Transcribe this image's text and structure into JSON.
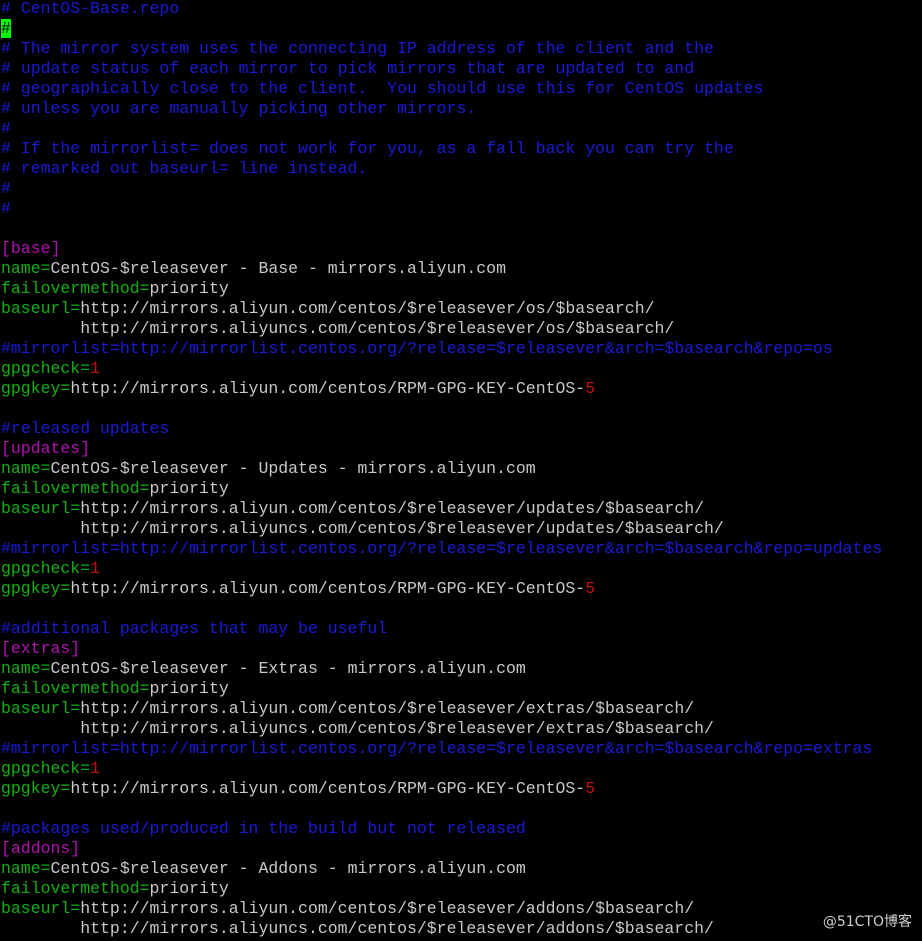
{
  "colors": {
    "background": "#000000",
    "comment": "#1a1ad6",
    "section": "#b010b0",
    "key": "#10b010",
    "value": "#c8c8c8",
    "number": "#c81010",
    "cursor": "#00ff00"
  },
  "lines": [
    [
      {
        "t": "# CentOS-Base.repo",
        "c": "comment"
      }
    ],
    [
      {
        "t": "#",
        "c": "cursor"
      }
    ],
    [
      {
        "t": "# The mirror system uses the connecting IP address of the client and the",
        "c": "comment"
      }
    ],
    [
      {
        "t": "# update status of each mirror to pick mirrors that are updated to and",
        "c": "comment"
      }
    ],
    [
      {
        "t": "# geographically close to the client.  You should use this for CentOS updates",
        "c": "comment"
      }
    ],
    [
      {
        "t": "# unless you are manually picking other mirrors.",
        "c": "comment"
      }
    ],
    [
      {
        "t": "#",
        "c": "comment"
      }
    ],
    [
      {
        "t": "# If the mirrorlist= does not work for you, as a fall back you can try the",
        "c": "comment"
      }
    ],
    [
      {
        "t": "# remarked out baseurl= line instead.",
        "c": "comment"
      }
    ],
    [
      {
        "t": "#",
        "c": "comment"
      }
    ],
    [
      {
        "t": "#",
        "c": "comment"
      }
    ],
    [],
    [
      {
        "t": "[base]",
        "c": "section"
      }
    ],
    [
      {
        "t": "name=",
        "c": "key"
      },
      {
        "t": "CentOS-$releasever - Base - mirrors.aliyun.com",
        "c": "value"
      }
    ],
    [
      {
        "t": "failovermethod=",
        "c": "key"
      },
      {
        "t": "priority",
        "c": "value"
      }
    ],
    [
      {
        "t": "baseurl=",
        "c": "key"
      },
      {
        "t": "http://mirrors.aliyun.com/centos/$releasever/os/$basearch/",
        "c": "value"
      }
    ],
    [
      {
        "t": "        http://mirrors.aliyuncs.com/centos/$releasever/os/$basearch/",
        "c": "value"
      }
    ],
    [
      {
        "t": "#mirrorlist=http://mirrorlist.centos.org/?release=$releasever&arch=$basearch&repo=os",
        "c": "comment"
      }
    ],
    [
      {
        "t": "gpgcheck=",
        "c": "key"
      },
      {
        "t": "1",
        "c": "number"
      }
    ],
    [
      {
        "t": "gpgkey=",
        "c": "key"
      },
      {
        "t": "http://mirrors.aliyun.com/centos/RPM-GPG-KEY-CentOS-",
        "c": "value"
      },
      {
        "t": "5",
        "c": "number"
      }
    ],
    [],
    [
      {
        "t": "#released updates",
        "c": "comment"
      }
    ],
    [
      {
        "t": "[updates]",
        "c": "section"
      }
    ],
    [
      {
        "t": "name=",
        "c": "key"
      },
      {
        "t": "CentOS-$releasever - Updates - mirrors.aliyun.com",
        "c": "value"
      }
    ],
    [
      {
        "t": "failovermethod=",
        "c": "key"
      },
      {
        "t": "priority",
        "c": "value"
      }
    ],
    [
      {
        "t": "baseurl=",
        "c": "key"
      },
      {
        "t": "http://mirrors.aliyun.com/centos/$releasever/updates/$basearch/",
        "c": "value"
      }
    ],
    [
      {
        "t": "        http://mirrors.aliyuncs.com/centos/$releasever/updates/$basearch/",
        "c": "value"
      }
    ],
    [
      {
        "t": "#mirrorlist=http://mirrorlist.centos.org/?release=$releasever&arch=$basearch&repo=updates",
        "c": "comment"
      }
    ],
    [
      {
        "t": "gpgcheck=",
        "c": "key"
      },
      {
        "t": "1",
        "c": "number"
      }
    ],
    [
      {
        "t": "gpgkey=",
        "c": "key"
      },
      {
        "t": "http://mirrors.aliyun.com/centos/RPM-GPG-KEY-CentOS-",
        "c": "value"
      },
      {
        "t": "5",
        "c": "number"
      }
    ],
    [],
    [
      {
        "t": "#additional packages that may be useful",
        "c": "comment"
      }
    ],
    [
      {
        "t": "[extras]",
        "c": "section"
      }
    ],
    [
      {
        "t": "name=",
        "c": "key"
      },
      {
        "t": "CentOS-$releasever - Extras - mirrors.aliyun.com",
        "c": "value"
      }
    ],
    [
      {
        "t": "failovermethod=",
        "c": "key"
      },
      {
        "t": "priority",
        "c": "value"
      }
    ],
    [
      {
        "t": "baseurl=",
        "c": "key"
      },
      {
        "t": "http://mirrors.aliyun.com/centos/$releasever/extras/$basearch/",
        "c": "value"
      }
    ],
    [
      {
        "t": "        http://mirrors.aliyuncs.com/centos/$releasever/extras/$basearch/",
        "c": "value"
      }
    ],
    [
      {
        "t": "#mirrorlist=http://mirrorlist.centos.org/?release=$releasever&arch=$basearch&repo=extras",
        "c": "comment"
      }
    ],
    [
      {
        "t": "gpgcheck=",
        "c": "key"
      },
      {
        "t": "1",
        "c": "number"
      }
    ],
    [
      {
        "t": "gpgkey=",
        "c": "key"
      },
      {
        "t": "http://mirrors.aliyun.com/centos/RPM-GPG-KEY-CentOS-",
        "c": "value"
      },
      {
        "t": "5",
        "c": "number"
      }
    ],
    [],
    [
      {
        "t": "#packages used/produced in the build but not released",
        "c": "comment"
      }
    ],
    [
      {
        "t": "[addons]",
        "c": "section"
      }
    ],
    [
      {
        "t": "name=",
        "c": "key"
      },
      {
        "t": "CentOS-$releasever - Addons - mirrors.aliyun.com",
        "c": "value"
      }
    ],
    [
      {
        "t": "failovermethod=",
        "c": "key"
      },
      {
        "t": "priority",
        "c": "value"
      }
    ],
    [
      {
        "t": "baseurl=",
        "c": "key"
      },
      {
        "t": "http://mirrors.aliyun.com/centos/$releasever/addons/$basearch/",
        "c": "value"
      }
    ],
    [
      {
        "t": "        http://mirrors.aliyuncs.com/centos/$releasever/addons/$basearch/",
        "c": "value"
      }
    ]
  ],
  "watermark": "@51CTO博客"
}
